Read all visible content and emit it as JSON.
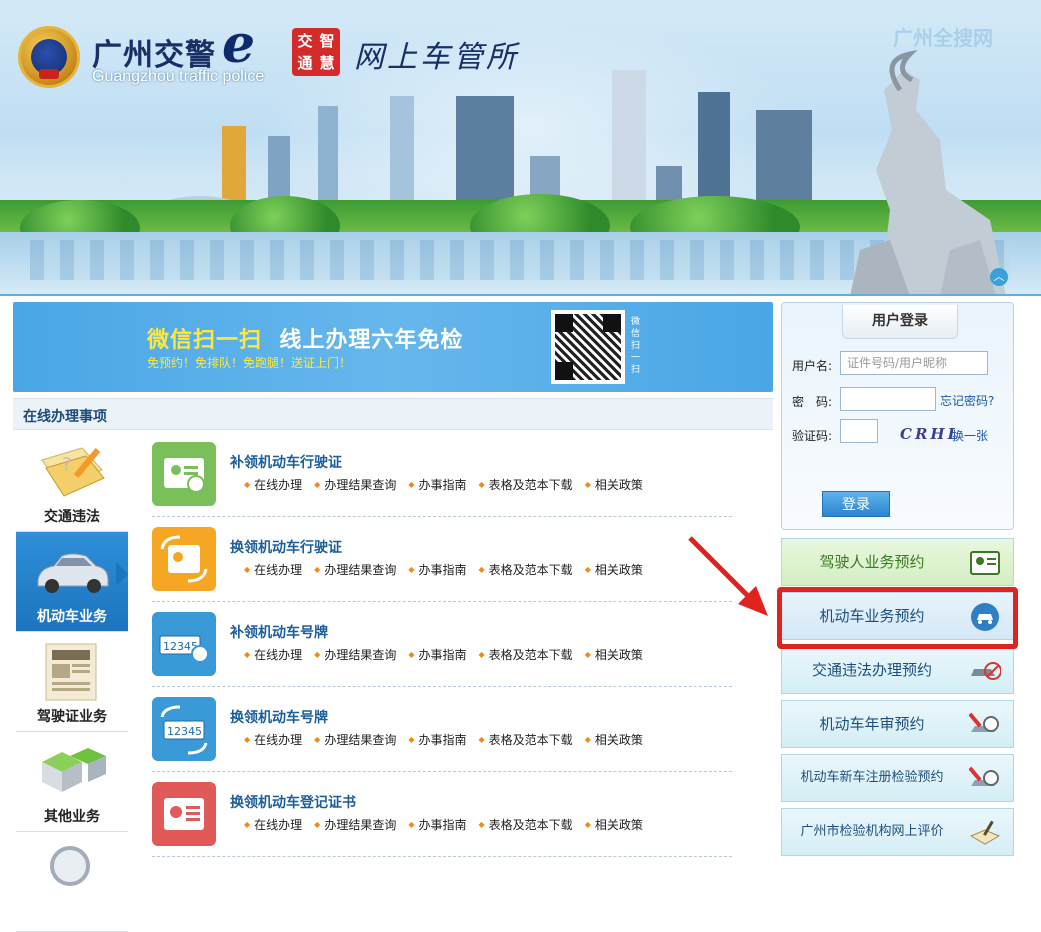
{
  "header": {
    "title": "广州交警",
    "title_e": "e",
    "subtitle": "Guangzhou traffic police",
    "seal": [
      "交",
      "智",
      "通",
      "慧"
    ],
    "station": "网上车管所",
    "watermark": "广州全搜网"
  },
  "promo": {
    "title_prefix": "微信扫一扫",
    "title_main": "线上办理六年免检",
    "subtitle": "免预约！免排队！免跑腿！送证上门！",
    "qr_caption": "微信扫一扫"
  },
  "section": {
    "title": "在线办理事项"
  },
  "left_tabs": [
    {
      "label": "交通违法",
      "active": false
    },
    {
      "label": "机动车业务",
      "active": true
    },
    {
      "label": "驾驶证业务",
      "active": false
    },
    {
      "label": "其他业务",
      "active": false
    }
  ],
  "items": [
    {
      "title": "补领机动车行驶证",
      "color": "#7bbf5a",
      "icon": "license-card-icon"
    },
    {
      "title": "换领机动车行驶证",
      "color": "#f5a623",
      "icon": "license-swap-icon"
    },
    {
      "title": "补领机动车号牌",
      "color": "#3a9ad8",
      "icon": "plate-icon"
    },
    {
      "title": "换领机动车号牌",
      "color": "#3a9ad8",
      "icon": "plate-swap-icon"
    },
    {
      "title": "换领机动车登记证书",
      "color": "#e05a5a",
      "icon": "certificate-icon"
    }
  ],
  "item_links": [
    "在线办理",
    "办理结果查询",
    "办事指南",
    "表格及范本下载",
    "相关政策"
  ],
  "login": {
    "tab": "用户登录",
    "username_label": "用户名:",
    "username_placeholder": "证件号码/用户昵称",
    "password_label": "密　码:",
    "forgot": "忘记密码?",
    "captcha_label": "验证码:",
    "captcha_text": "CRHL",
    "refresh": "换一张",
    "submit": "登录"
  },
  "right_buttons": [
    {
      "label": "驾驶人业务预约",
      "style": "g",
      "icon": "id-card-icon"
    },
    {
      "label": "机动车业务预约",
      "style": "b",
      "icon": "car-circle-icon"
    },
    {
      "label": "交通违法办理预约",
      "style": "c",
      "icon": "no-car-icon"
    },
    {
      "label": "机动车年审预约",
      "style": "c",
      "icon": "inspect-car-icon"
    },
    {
      "label": "机动车新车注册检验预约",
      "style": "c",
      "icon": "new-car-inspect-icon"
    },
    {
      "label": "广州市检验机构网上评价",
      "style": "c",
      "icon": "book-pen-icon"
    }
  ],
  "colors": {
    "accent": "#1c74bf",
    "highlight": "#e0231c",
    "promo": "#4aa6e6"
  }
}
